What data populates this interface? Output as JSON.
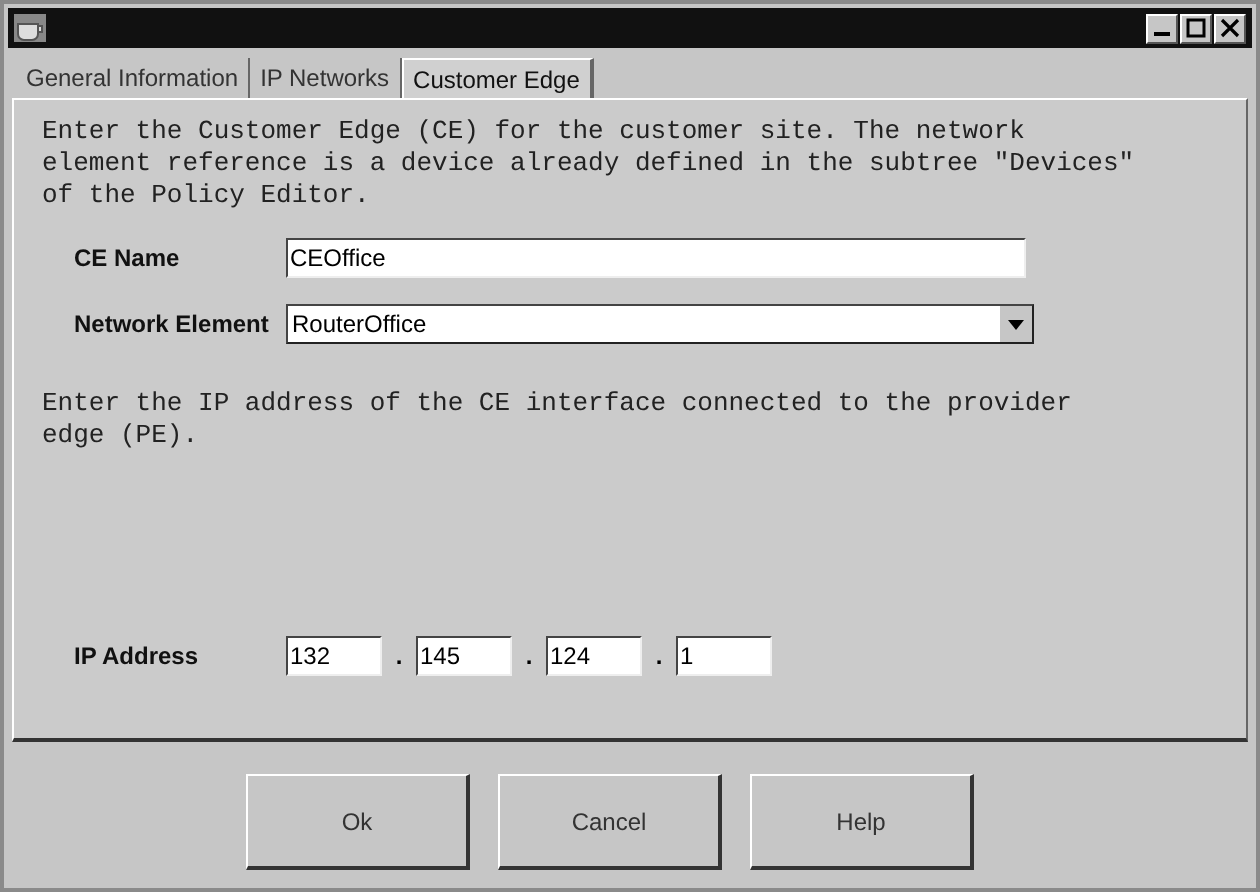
{
  "tabs": [
    {
      "label": "General Information",
      "selected": false
    },
    {
      "label": "IP Networks",
      "selected": false
    },
    {
      "label": "Customer Edge",
      "selected": true
    }
  ],
  "intro": [
    "Enter the Customer Edge (CE) for the customer site. The network",
    "element reference is a device already defined in the subtree \"Devices\"",
    "of the Policy Editor."
  ],
  "ce_name": {
    "label": "CE Name",
    "value": "CEOffice"
  },
  "network_element": {
    "label": "Network Element",
    "value": "RouterOffice"
  },
  "ip_intro": [
    "Enter the IP address of the CE interface connected to the provider",
    "edge (PE)."
  ],
  "ip_address": {
    "label": "IP Address",
    "octets": [
      "132",
      "145",
      "124",
      "1"
    ],
    "separators": [
      ".",
      ".",
      "."
    ]
  },
  "buttons": [
    "Ok",
    "Cancel",
    "Help"
  ]
}
